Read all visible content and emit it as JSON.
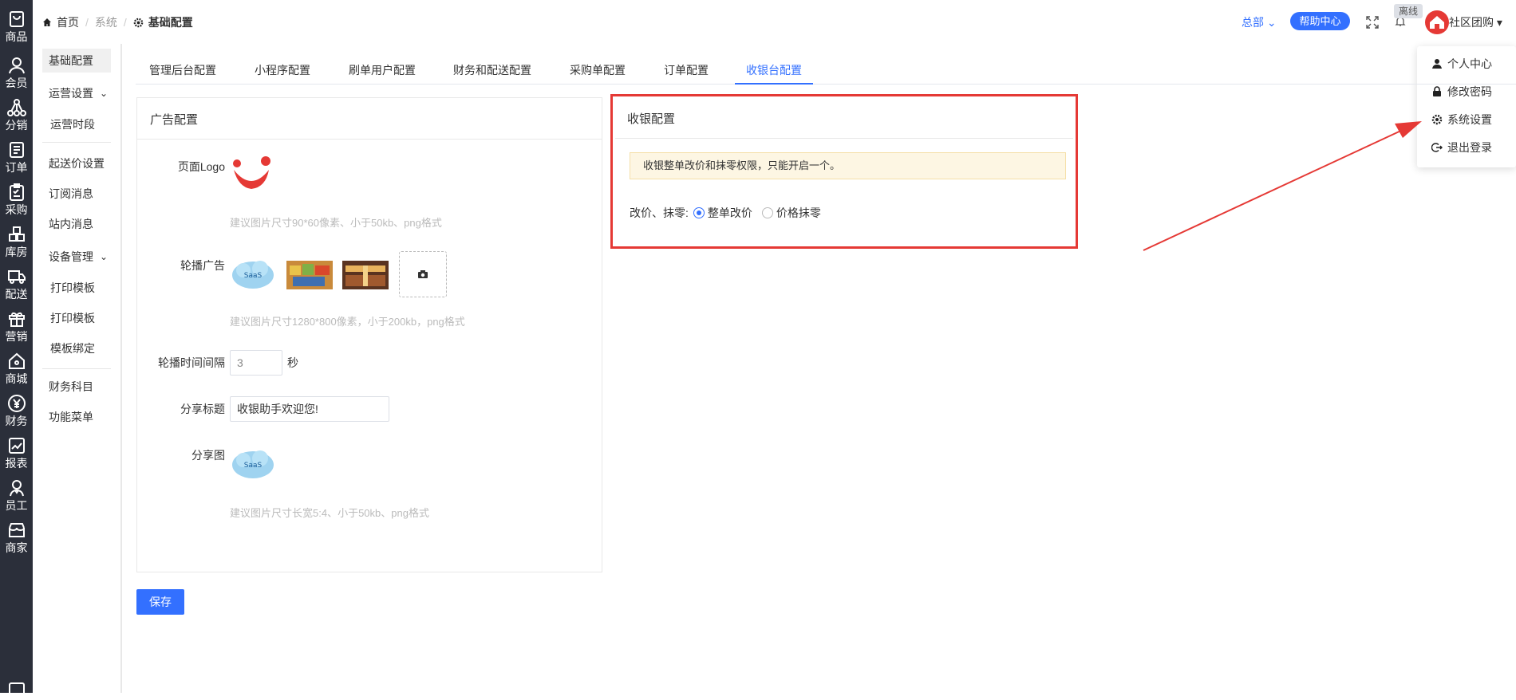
{
  "iconbar": [
    {
      "label": "商品",
      "icon": "bag-icon"
    },
    {
      "label": "会员",
      "icon": "user-icon"
    },
    {
      "label": "分销",
      "icon": "network-icon"
    },
    {
      "label": "订单",
      "icon": "order-icon"
    },
    {
      "label": "采购",
      "icon": "clipboard-icon"
    },
    {
      "label": "库房",
      "icon": "warehouse-icon"
    },
    {
      "label": "配送",
      "icon": "truck-icon"
    },
    {
      "label": "营销",
      "icon": "gift-icon"
    },
    {
      "label": "商城",
      "icon": "store-icon"
    },
    {
      "label": "财务",
      "icon": "yen-icon"
    },
    {
      "label": "报表",
      "icon": "chart-icon"
    },
    {
      "label": "员工",
      "icon": "staff-icon"
    },
    {
      "label": "商家",
      "icon": "shop-icon"
    }
  ],
  "subnav": {
    "items": [
      "基础配置",
      "运营设置",
      "运营时段",
      "起送价设置",
      "订阅消息",
      "站内消息",
      "设备管理",
      "打印模板",
      "打印模板",
      "模板绑定",
      "财务科目",
      "功能菜单"
    ]
  },
  "header": {
    "breadcrumb": {
      "home": "首页",
      "mid": "系统",
      "current": "基础配置"
    },
    "org": "总部",
    "help": "帮助中心",
    "offline": "离线",
    "user": "社区团购"
  },
  "dropdown": [
    "个人中心",
    "修改密码",
    "系统设置",
    "退出登录"
  ],
  "tabs": [
    "管理后台配置",
    "小程序配置",
    "刷单用户配置",
    "财务和配送配置",
    "采购单配置",
    "订单配置",
    "收银台配置"
  ],
  "ad_panel": {
    "title": "广告配置",
    "logo_label": "页面Logo",
    "logo_hint": "建议图片尺寸90*60像素、小于50kb、png格式",
    "banner_label": "轮播广告",
    "banner_hint": "建议图片尺寸1280*800像素，小于200kb，png格式",
    "interval_label": "轮播时间间隔",
    "interval_value": "3",
    "interval_unit": "秒",
    "share_title_label": "分享标题",
    "share_title_value": "收银助手欢迎您!",
    "share_img_label": "分享图",
    "share_img_hint": "建议图片尺寸长宽5:4、小于50kb、png格式",
    "saas_text": "SaaS"
  },
  "save_label": "保存",
  "cashier": {
    "title": "收银配置",
    "notice": "收银整单改价和抹零权限，只能开启一个。",
    "radio_label": "改价、抹零:",
    "option1": "整单改价",
    "option2": "价格抹零",
    "selected": "整单改价"
  },
  "colors": {
    "accent": "#3370ff",
    "highlight": "#e53935",
    "sidebar": "#2b2f3a"
  }
}
